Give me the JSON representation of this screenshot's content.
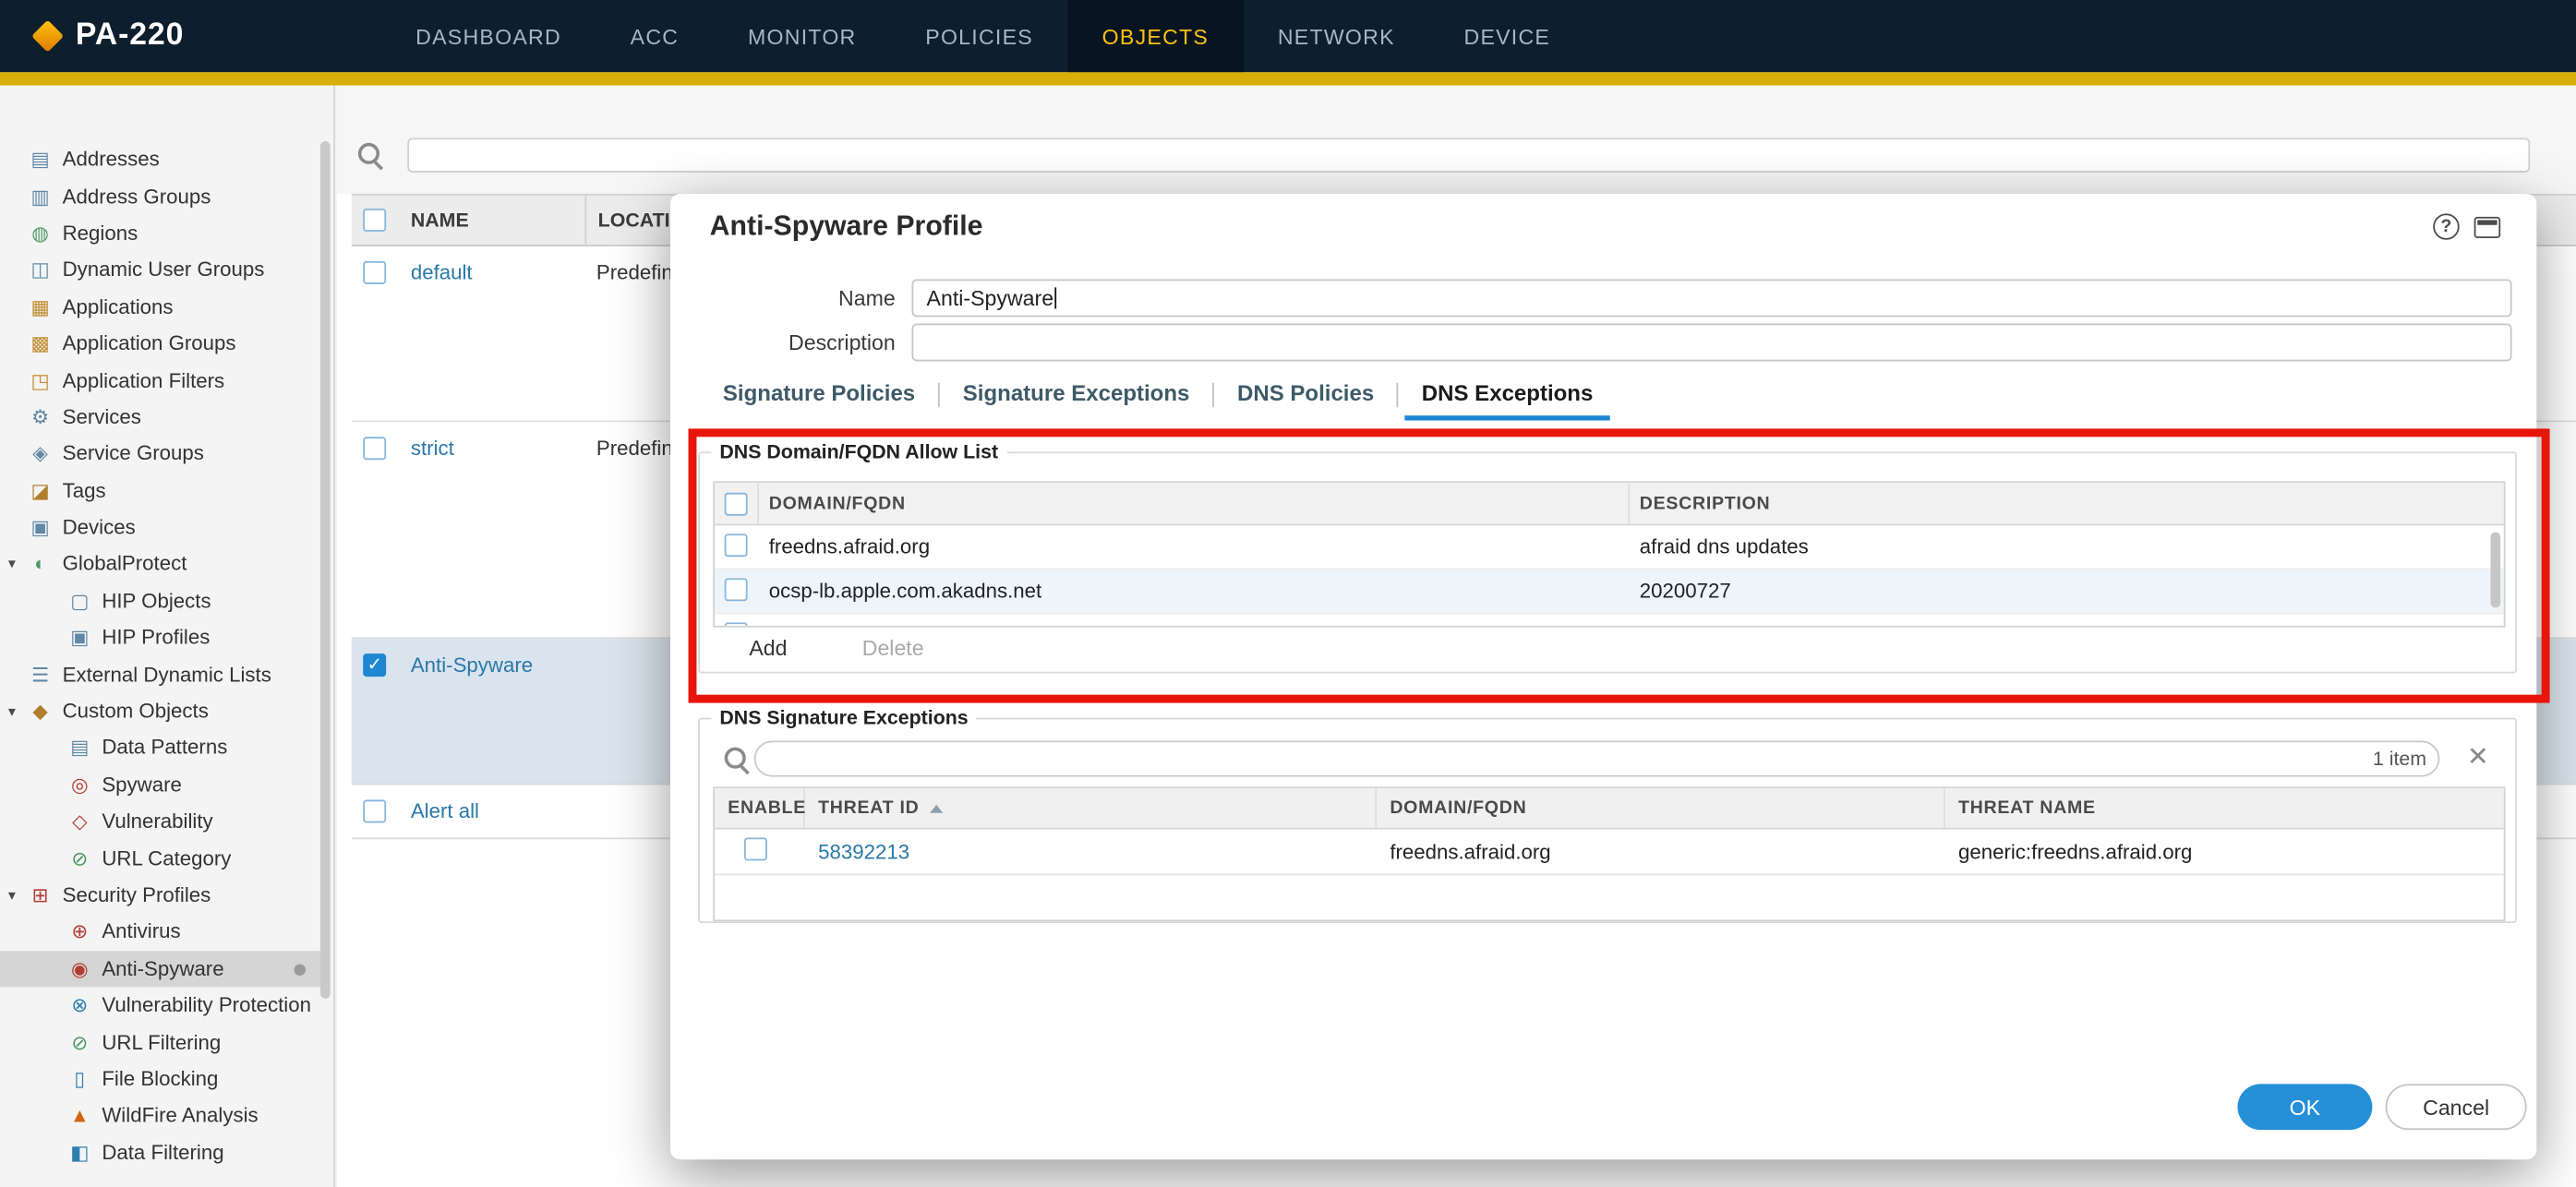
{
  "colors": {
    "nav_bg": "#0d1e2d",
    "accent_stripe": "#d9ae08",
    "nav_active_text": "#ffc20e",
    "link_blue": "#2a78a8",
    "primary_blue": "#1d87d2",
    "selected_row_bg": "#dae4ee",
    "annotation_red": "#e8150a"
  },
  "header": {
    "device_name": "PA-220",
    "nav_items": [
      {
        "label": "DASHBOARD",
        "active": false
      },
      {
        "label": "ACC",
        "active": false
      },
      {
        "label": "MONITOR",
        "active": false
      },
      {
        "label": "POLICIES",
        "active": false
      },
      {
        "label": "OBJECTS",
        "active": true
      },
      {
        "label": "NETWORK",
        "active": false
      },
      {
        "label": "DEVICE",
        "active": false
      }
    ]
  },
  "sidebar": {
    "items": [
      {
        "label": "Addresses",
        "level": 0,
        "icon": "▤",
        "icon_color": "#6188a5",
        "expandable": false,
        "selected": false
      },
      {
        "label": "Address Groups",
        "level": 0,
        "icon": "▥",
        "icon_color": "#6188a5",
        "expandable": false,
        "selected": false
      },
      {
        "label": "Regions",
        "level": 0,
        "icon": "◍",
        "icon_color": "#4c9a63",
        "expandable": false,
        "selected": false
      },
      {
        "label": "Dynamic User Groups",
        "level": 0,
        "icon": "◫",
        "icon_color": "#6188a5",
        "expandable": false,
        "selected": false
      },
      {
        "label": "Applications",
        "level": 0,
        "icon": "▦",
        "icon_color": "#c08a2d",
        "expandable": false,
        "selected": false
      },
      {
        "label": "Application Groups",
        "level": 0,
        "icon": "▩",
        "icon_color": "#c08a2d",
        "expandable": false,
        "selected": false
      },
      {
        "label": "Application Filters",
        "level": 0,
        "icon": "◳",
        "icon_color": "#c08a2d",
        "expandable": false,
        "selected": false
      },
      {
        "label": "Services",
        "level": 0,
        "icon": "⚙",
        "icon_color": "#6188a5",
        "expandable": false,
        "selected": false
      },
      {
        "label": "Service Groups",
        "level": 0,
        "icon": "◈",
        "icon_color": "#6188a5",
        "expandable": false,
        "selected": false
      },
      {
        "label": "Tags",
        "level": 0,
        "icon": "◪",
        "icon_color": "#b07f2e",
        "expandable": false,
        "selected": false
      },
      {
        "label": "Devices",
        "level": 0,
        "icon": "▣",
        "icon_color": "#6188a5",
        "expandable": false,
        "selected": false
      },
      {
        "label": "GlobalProtect",
        "level": 0,
        "icon": "◐",
        "icon_color": "#4c9a63",
        "expandable": true,
        "selected": false
      },
      {
        "label": "HIP Objects",
        "level": 1,
        "icon": "▢",
        "icon_color": "#6188a5",
        "expandable": false,
        "selected": false
      },
      {
        "label": "HIP Profiles",
        "level": 1,
        "icon": "▣",
        "icon_color": "#6188a5",
        "expandable": false,
        "selected": false
      },
      {
        "label": "External Dynamic Lists",
        "level": 0,
        "icon": "☰",
        "icon_color": "#6188a5",
        "expandable": false,
        "selected": false
      },
      {
        "label": "Custom Objects",
        "level": 0,
        "icon": "◆",
        "icon_color": "#b07f2e",
        "expandable": true,
        "selected": false
      },
      {
        "label": "Data Patterns",
        "level": 1,
        "icon": "▤",
        "icon_color": "#6188a5",
        "expandable": false,
        "selected": false
      },
      {
        "label": "Spyware",
        "level": 1,
        "icon": "◎",
        "icon_color": "#b23c31",
        "expandable": false,
        "selected": false
      },
      {
        "label": "Vulnerability",
        "level": 1,
        "icon": "◇",
        "icon_color": "#b23c31",
        "expandable": false,
        "selected": false
      },
      {
        "label": "URL Category",
        "level": 1,
        "icon": "⊘",
        "icon_color": "#4c9a63",
        "expandable": false,
        "selected": false
      },
      {
        "label": "Security Profiles",
        "level": 0,
        "icon": "⊞",
        "icon_color": "#b23c31",
        "expandable": true,
        "selected": false
      },
      {
        "label": "Antivirus",
        "level": 1,
        "icon": "⊕",
        "icon_color": "#b23c31",
        "expandable": false,
        "selected": false
      },
      {
        "label": "Anti-Spyware",
        "level": 1,
        "icon": "◉",
        "icon_color": "#b23c31",
        "expandable": false,
        "selected": true
      },
      {
        "label": "Vulnerability Protection",
        "level": 1,
        "icon": "⊗",
        "icon_color": "#2e7fae",
        "expandable": false,
        "selected": false
      },
      {
        "label": "URL Filtering",
        "level": 1,
        "icon": "⊘",
        "icon_color": "#4c9a63",
        "expandable": false,
        "selected": false
      },
      {
        "label": "File Blocking",
        "level": 1,
        "icon": "▯",
        "icon_color": "#2e7fae",
        "expandable": false,
        "selected": false
      },
      {
        "label": "WildFire Analysis",
        "level": 1,
        "icon": "▲",
        "icon_color": "#d3650e",
        "expandable": false,
        "selected": false
      },
      {
        "label": "Data Filtering",
        "level": 1,
        "icon": "◧",
        "icon_color": "#2e7fae",
        "expandable": false,
        "selected": false
      }
    ]
  },
  "main": {
    "search_value": "",
    "columns": [
      "NAME",
      "LOCATION"
    ],
    "rows": [
      {
        "name": "default",
        "location": "Predefined",
        "checked": false,
        "selected": false
      },
      {
        "name": "strict",
        "location": "Predefined",
        "checked": false,
        "selected": false
      },
      {
        "name": "Anti-Spyware",
        "location": "",
        "checked": true,
        "selected": true
      },
      {
        "name": "Alert all",
        "location": "",
        "checked": false,
        "selected": false
      }
    ]
  },
  "dialog": {
    "title": "Anti-Spyware Profile",
    "name_label": "Name",
    "name_value": "Anti-Spyware",
    "description_label": "Description",
    "description_value": "",
    "tabs": [
      {
        "label": "Signature Policies",
        "active": false
      },
      {
        "label": "Signature Exceptions",
        "active": false
      },
      {
        "label": "DNS Policies",
        "active": false
      },
      {
        "label": "DNS Exceptions",
        "active": true
      }
    ],
    "allow_list": {
      "section_title": "DNS Domain/FQDN Allow List",
      "columns": [
        "DOMAIN/FQDN",
        "DESCRIPTION"
      ],
      "rows": [
        {
          "domain": "freedns.afraid.org",
          "description": "afraid dns updates",
          "checked": false
        },
        {
          "domain": "ocsp-lb.apple.com.akadns.net",
          "description": "20200727",
          "checked": false
        }
      ],
      "add_label": "Add",
      "delete_label": "Delete"
    },
    "exceptions": {
      "section_title": "DNS Signature Exceptions",
      "search_value": "",
      "item_count": "1 item",
      "columns": [
        "ENABLE",
        "THREAT ID",
        "DOMAIN/FQDN",
        "THREAT NAME"
      ],
      "sort_column": "THREAT ID",
      "sort_direction": "asc",
      "rows": [
        {
          "enabled": false,
          "threat_id": "58392213",
          "domain": "freedns.afraid.org",
          "threat_name": "generic:freedns.afraid.org"
        }
      ]
    },
    "ok_label": "OK",
    "cancel_label": "Cancel"
  }
}
